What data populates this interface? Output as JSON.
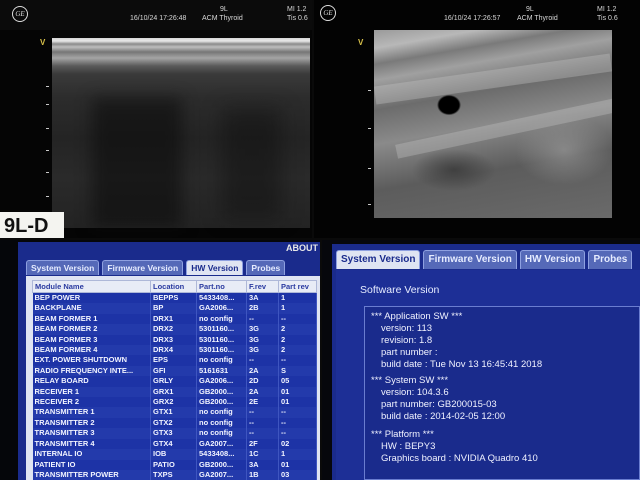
{
  "monitors": {
    "left": {
      "logo": "GE",
      "probe": "9L",
      "datetime": "16/10/24 17:26:48",
      "preset": "ACM Thyroid",
      "mi": "MI 1.2",
      "tis": "Tis 0.6",
      "marker": "V"
    },
    "right": {
      "logo": "GE",
      "probe": "9L",
      "datetime": "16/10/24 17:26:57",
      "preset": "ACM Thyroid",
      "mi": "MI 1.2",
      "tis": "Tis 0.6",
      "marker": "V"
    },
    "probe_label": "9L-D"
  },
  "hw_screen": {
    "header": "ABOUT",
    "tabs": [
      "System Version",
      "Firmware Version",
      "HW Version",
      "Probes"
    ],
    "active_tab": "HW Version",
    "columns": [
      "Module Name",
      "Location",
      "Part.no",
      "F.rev",
      "Part rev"
    ],
    "rows": [
      [
        "BEP POWER",
        "BEPPS",
        "5433408...",
        "3A",
        "1"
      ],
      [
        "BACKPLANE",
        "BP",
        "GA2006...",
        "2B",
        "1"
      ],
      [
        "BEAM FORMER 1",
        "DRX1",
        "no config",
        "--",
        "--"
      ],
      [
        "BEAM FORMER 2",
        "DRX2",
        "5301160...",
        "3G",
        "2"
      ],
      [
        "BEAM FORMER 3",
        "DRX3",
        "5301160...",
        "3G",
        "2"
      ],
      [
        "BEAM FORMER 4",
        "DRX4",
        "5301160...",
        "3G",
        "2"
      ],
      [
        "EXT. POWER SHUTDOWN",
        "EPS",
        "no config",
        "--",
        "--"
      ],
      [
        "RADIO FREQUENCY INTE...",
        "GFI",
        "5161631",
        "2A",
        "S"
      ],
      [
        "RELAY BOARD",
        "GRLY",
        "GA2006...",
        "2D",
        "05"
      ],
      [
        "RECEIVER 1",
        "GRX1",
        "GB2000...",
        "2A",
        "01"
      ],
      [
        "RECEIVER 2",
        "GRX2",
        "GB2000...",
        "2E",
        "01"
      ],
      [
        "TRANSMITTER 1",
        "GTX1",
        "no config",
        "--",
        "--"
      ],
      [
        "TRANSMITTER 2",
        "GTX2",
        "no config",
        "--",
        "--"
      ],
      [
        "TRANSMITTER 3",
        "GTX3",
        "no config",
        "--",
        "--"
      ],
      [
        "TRANSMITTER 4",
        "GTX4",
        "GA2007...",
        "2F",
        "02"
      ],
      [
        "INTERNAL IO",
        "IOB",
        "5433408...",
        "1C",
        "1"
      ],
      [
        "PATIENT IO",
        "PATIO",
        "GB2000...",
        "3A",
        "01"
      ],
      [
        "TRANSMITTER POWER",
        "TXPS",
        "GA2007...",
        "1B",
        "03"
      ]
    ]
  },
  "sw_screen": {
    "tabs": [
      "System Version",
      "Firmware Version",
      "HW Version",
      "Probes"
    ],
    "active_tab": "System Version",
    "title": "Software Version",
    "lines": [
      "*** Application SW ***",
      "version: 113",
      "revision: 1.8",
      "part number :",
      "build date : Tue Nov 13 16:45:41 2018",
      "*** System SW ***",
      "version: 104.3.6",
      "part number: GB200015-03",
      "build date : 2014-02-05 12:00",
      "*** Platform ***",
      "HW : BEPY3",
      "Graphics board : NVIDIA Quadro 410"
    ]
  },
  "colors": {
    "screen_blue": "#1a2b8c",
    "panel_light": "#dfe4f2",
    "text_light": "#f0f2ff"
  }
}
